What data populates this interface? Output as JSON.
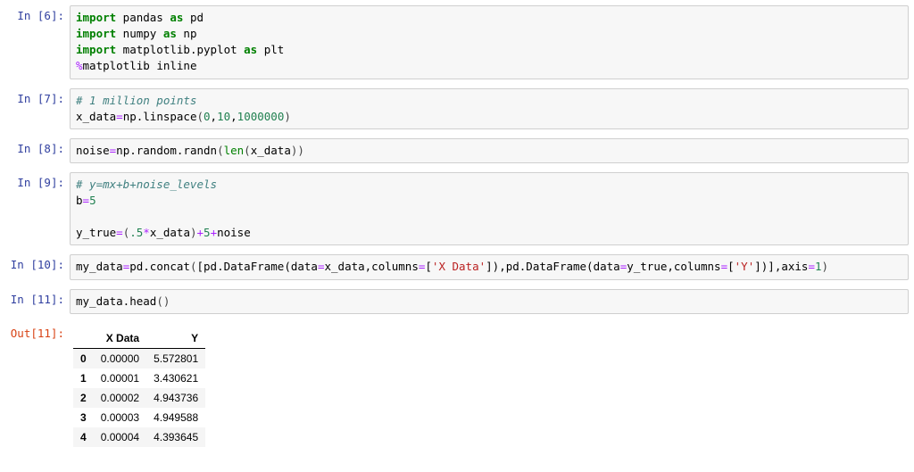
{
  "cells": {
    "c6": {
      "prompt": "In [6]:"
    },
    "c7": {
      "prompt": "In [7]:"
    },
    "c8": {
      "prompt": "In [8]:"
    },
    "c9": {
      "prompt": "In [9]:"
    },
    "c10": {
      "prompt": "In [10]:"
    },
    "c11_in": {
      "prompt": "In [11]:"
    },
    "c11_out": {
      "prompt": "Out[11]:"
    }
  },
  "code": {
    "c6": {
      "t_import1": "import",
      "t_pandas": " pandas ",
      "t_as1": "as",
      "t_pd": " pd",
      "t_import2": "import",
      "t_numpy": " numpy ",
      "t_as2": "as",
      "t_np": " np",
      "t_import3": "import",
      "t_mpl": " matplotlib.pyplot ",
      "t_as3": "as",
      "t_plt": " plt",
      "t_magic": "%",
      "t_magic_body": "matplotlib inline"
    },
    "c7": {
      "t_cmt": "# 1 million points",
      "t_left": "x_data",
      "t_eq": "=",
      "t_call1": "np.linspace",
      "t_open": "(",
      "t_n0": "0",
      "t_c1": ",",
      "t_n10": "10",
      "t_c2": ",",
      "t_n1m": "1000000",
      "t_close": ")"
    },
    "c8": {
      "t_left": "noise",
      "t_eq": "=",
      "t_call": "np.random.randn",
      "t_open": "(",
      "t_len": "len",
      "t_open2": "(",
      "t_xdata": "x_data",
      "t_close2": ")",
      "t_close": ")"
    },
    "c9": {
      "t_cmt": "# y=mx+b+noise_levels",
      "t_b": "b",
      "t_eq1": "=",
      "t_5": "5",
      "t_ytrue": "y_true",
      "t_eq2": "=",
      "t_open": "(",
      "t_dot5": ".5",
      "t_star": "*",
      "t_xdata": "x_data",
      "t_close": ")",
      "t_plus1": "+",
      "t_5b": "5",
      "t_plus2": "+",
      "t_noise": "noise"
    },
    "c10": {
      "t_left": "my_data",
      "t_eq": "=",
      "t_pd": "pd.concat",
      "t_open": "(",
      "t_brk1": "[",
      "t_df1a": "pd.DataFrame",
      "t_p1": "(data",
      "t_eq1": "=",
      "t_xd": "x_data,columns",
      "t_eq2": "=",
      "t_b1": "[",
      "t_str1": "'X Data'",
      "t_b2": "]",
      "t_pc1": ")",
      "t_c1": ",",
      "t_df2a": "pd.DataFrame",
      "t_p2": "(data",
      "t_eq3": "=",
      "t_yt": "y_true,columns",
      "t_eq4": "=",
      "t_b3": "[",
      "t_str2": "'Y'",
      "t_b4": "]",
      "t_pc2": ")",
      "t_brk2": "]",
      "t_c2": ",axis",
      "t_eq5": "=",
      "t_1": "1",
      "t_close": ")"
    },
    "c11": {
      "t_left": "my_data.head",
      "t_open": "(",
      "t_close": ")"
    }
  },
  "dataframe": {
    "columns": {
      "blank": "",
      "c1": "X Data",
      "c2": "Y"
    },
    "rows": [
      {
        "idx": "0",
        "x": "0.00000",
        "y": "5.572801"
      },
      {
        "idx": "1",
        "x": "0.00001",
        "y": "3.430621"
      },
      {
        "idx": "2",
        "x": "0.00002",
        "y": "4.943736"
      },
      {
        "idx": "3",
        "x": "0.00003",
        "y": "4.949588"
      },
      {
        "idx": "4",
        "x": "0.00004",
        "y": "4.393645"
      }
    ]
  }
}
